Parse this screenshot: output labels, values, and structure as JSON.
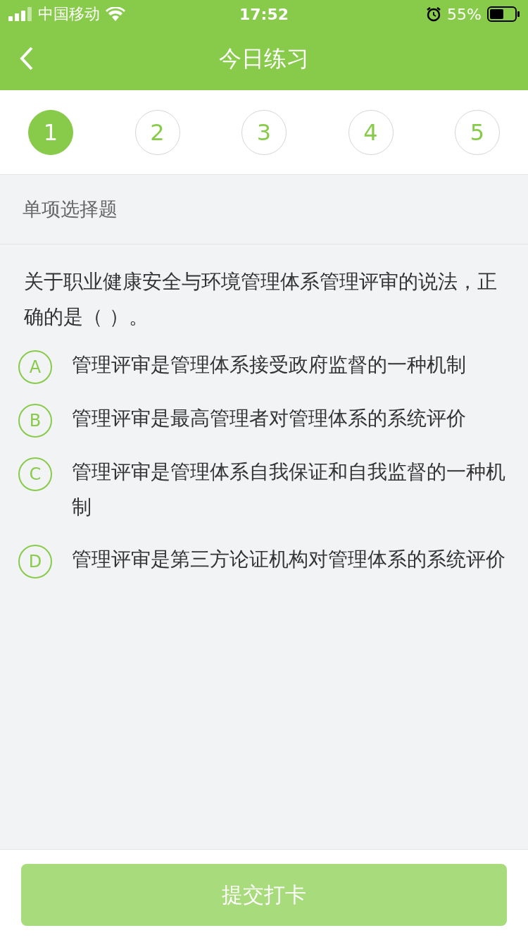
{
  "status_bar": {
    "carrier": "中国移动",
    "time": "17:52",
    "battery": "55%"
  },
  "nav": {
    "title": "今日练习"
  },
  "steps": [
    {
      "label": "1",
      "selected": true
    },
    {
      "label": "2",
      "selected": false
    },
    {
      "label": "3",
      "selected": false
    },
    {
      "label": "4",
      "selected": false
    },
    {
      "label": "5",
      "selected": false
    }
  ],
  "section": {
    "label": "单项选择题"
  },
  "question": "关于职业健康安全与环境管理体系管理评审的说法，正确的是（    ）。",
  "options": [
    {
      "letter": "A",
      "text": "管理评审是管理体系接受政府监督的一种机制",
      "selected": false
    },
    {
      "letter": "B",
      "text": "管理评审是最高管理者对管理体系的系统评价",
      "selected": false
    },
    {
      "letter": "C",
      "text": "管理评审是管理体系自我保证和自我监督的一种机制",
      "selected": false
    },
    {
      "letter": "D",
      "text": "管理评审是第三方论证机构对管理体系的系统评价",
      "selected": false
    }
  ],
  "submit": {
    "label": "提交打卡",
    "disabled": true
  }
}
